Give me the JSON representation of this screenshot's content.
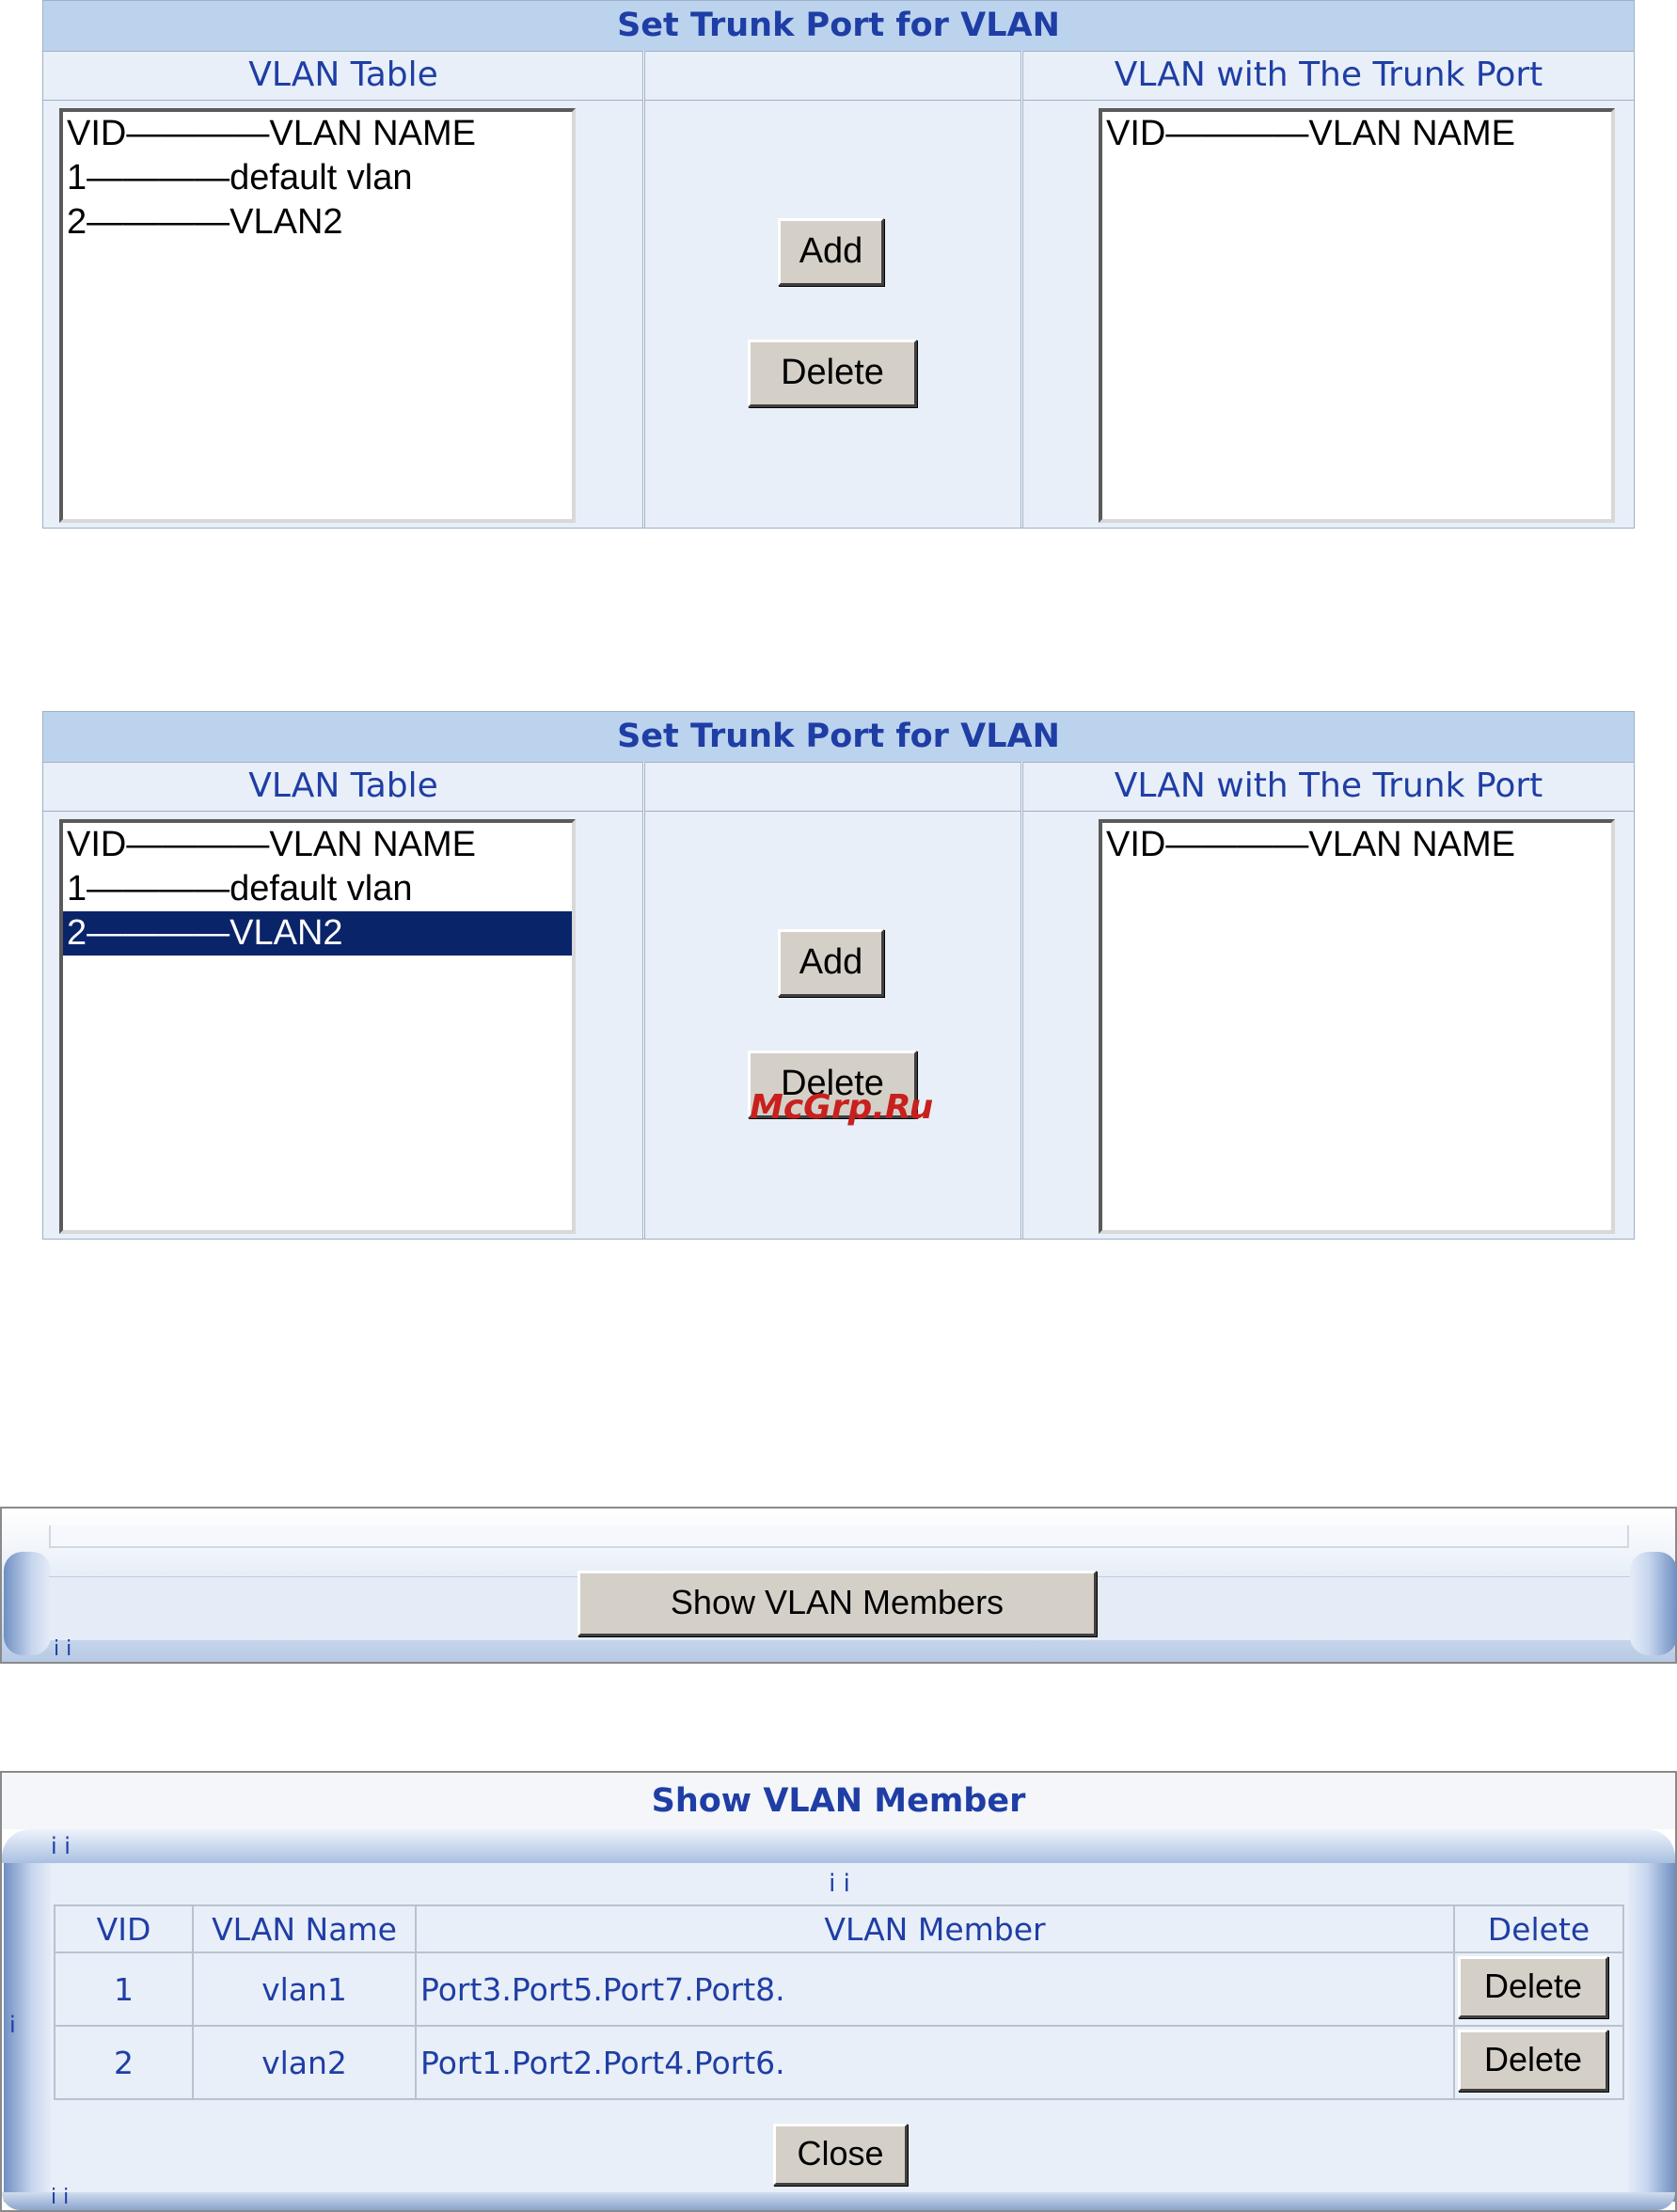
{
  "panel1": {
    "title": "Set Trunk Port for VLAN",
    "col_vlan_table": "VLAN Table",
    "col_vlan_trunk": "VLAN with The Trunk Port",
    "vlan_table": [
      {
        "text": "VID————VLAN NAME",
        "selected": false
      },
      {
        "text": "1————default vlan",
        "selected": false
      },
      {
        "text": "2————VLAN2",
        "selected": false
      }
    ],
    "trunk_table": [
      {
        "text": "VID————VLAN NAME"
      }
    ],
    "add_label": "Add",
    "delete_label": "Delete"
  },
  "panel2": {
    "title": "Set Trunk Port for VLAN",
    "col_vlan_table": "VLAN Table",
    "col_vlan_trunk": "VLAN with The Trunk Port",
    "vlan_table": [
      {
        "text": "VID————VLAN NAME",
        "selected": false
      },
      {
        "text": "1————default vlan",
        "selected": false
      },
      {
        "text": "2————VLAN2",
        "selected": true
      }
    ],
    "trunk_table": [
      {
        "text": "VID————VLAN NAME"
      }
    ],
    "add_label": "Add",
    "delete_label": "Delete",
    "watermark": "McGrp.Ru"
  },
  "members_bar": {
    "button_label": "Show VLAN Members",
    "stray_text": "i i"
  },
  "dialog": {
    "title": "Show VLAN Member",
    "stray_top": "i i",
    "stray_inner": "i i",
    "stray_left": "i",
    "stray_bottom": "i i",
    "headers": {
      "vid": "VID",
      "name": "VLAN Name",
      "member": "VLAN Member",
      "delete": "Delete"
    },
    "rows": [
      {
        "vid": "1",
        "name": "vlan1",
        "member": "Port3.Port5.Port7.Port8.",
        "delete_label": "Delete"
      },
      {
        "vid": "2",
        "name": "vlan2",
        "member": "Port1.Port2.Port4.Port6.",
        "delete_label": "Delete"
      }
    ],
    "close_label": "Close"
  },
  "colors": {
    "title_bg": "#bcd3ee",
    "panel_bg": "#e8eff8",
    "text_blue": "#1f3ea5",
    "selection": "#0a246a",
    "watermark": "#c8201e",
    "button_face": "#d4d0c8"
  }
}
